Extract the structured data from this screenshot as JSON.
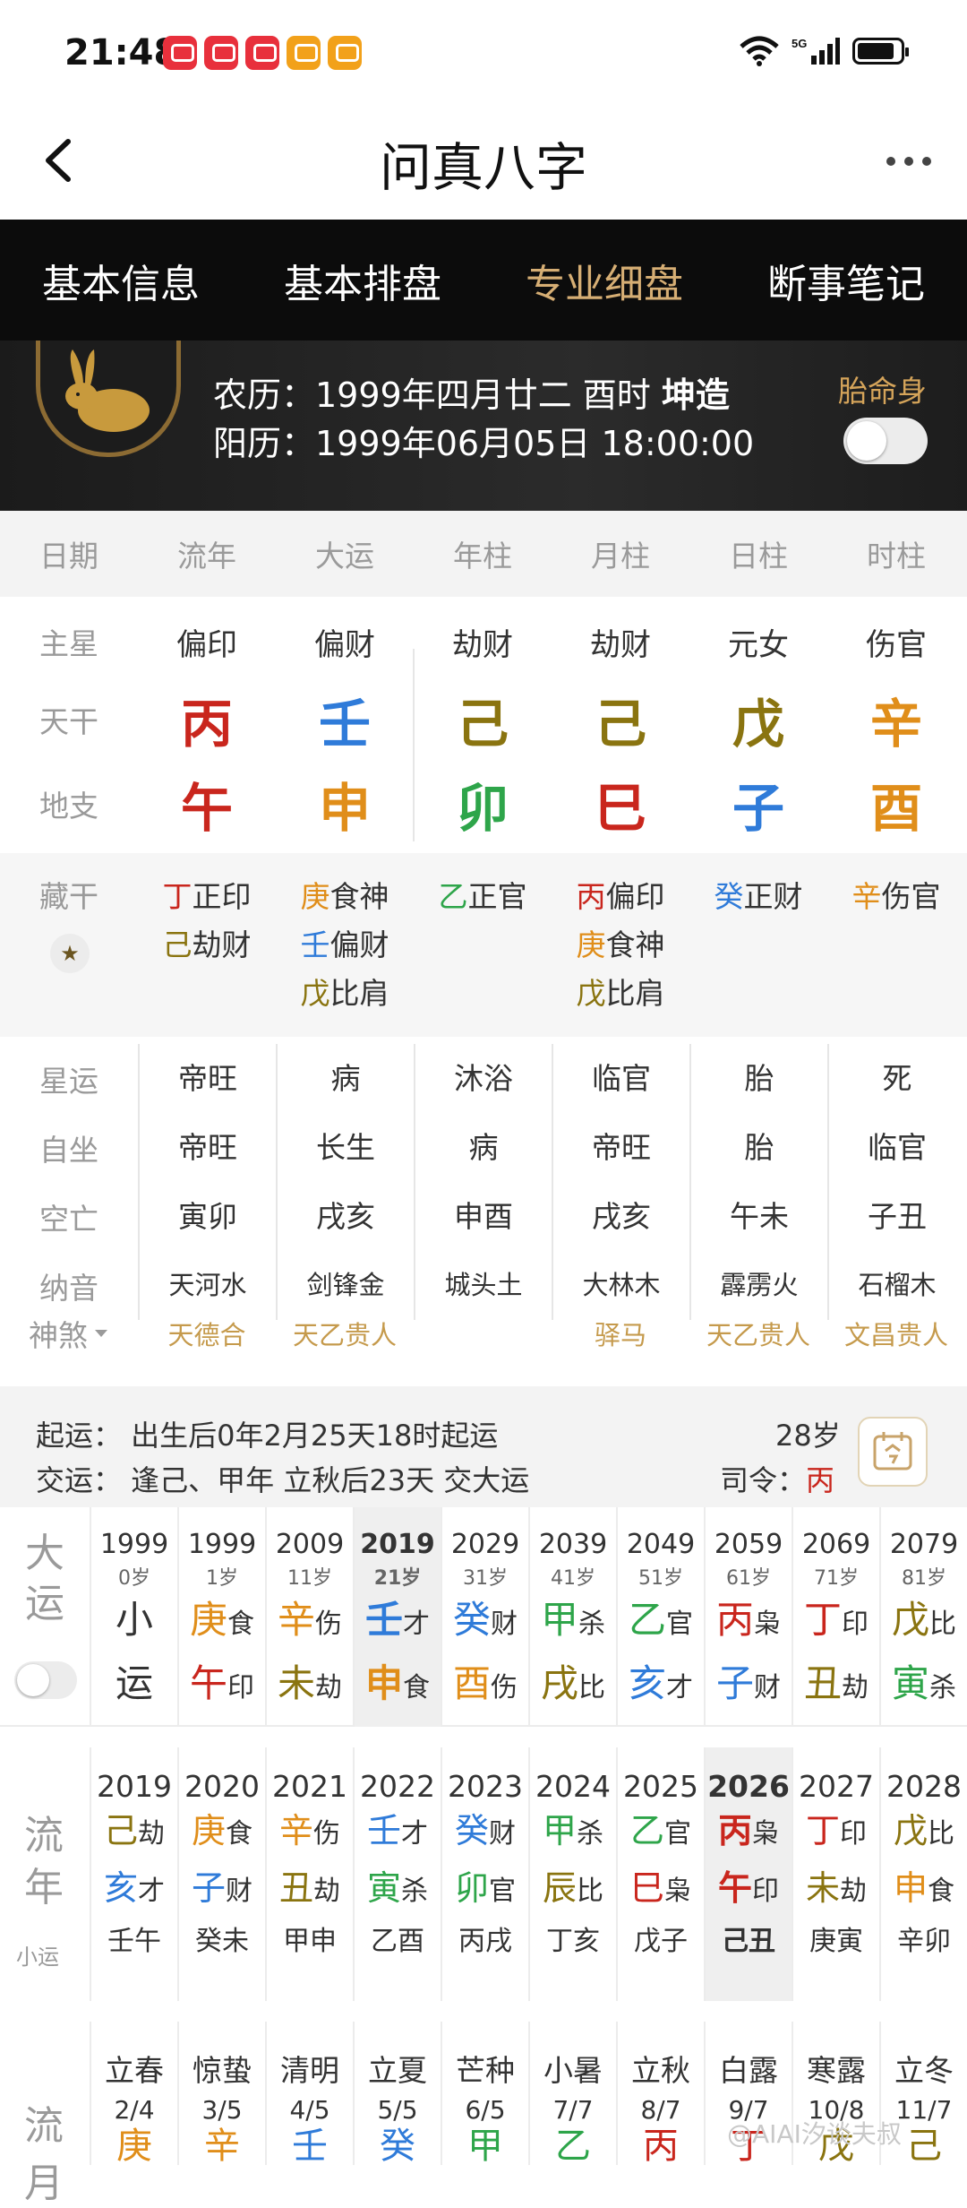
{
  "status": {
    "time": "21:48"
  },
  "appbar": {
    "title": "问真八字"
  },
  "tabs": [
    "基本信息",
    "基本排盘",
    "专业细盘",
    "断事笔记"
  ],
  "profile": {
    "lunar_prefix": "农历：1999年四月廿二 酉时",
    "lunar_bold": "坤造",
    "solar": "阳历：1999年06月05日 18:00:00",
    "taiming": "胎命身"
  },
  "header": [
    "日期",
    "流年",
    "大运",
    "年柱",
    "月柱",
    "日柱",
    "时柱"
  ],
  "labels": {
    "zhuxing": "主星",
    "tiangan": "天干",
    "dizhi": "地支",
    "canggan": "藏干"
  },
  "zhuxing": [
    "偏印",
    "偏财",
    "劫财",
    "劫财",
    "元女",
    "伤官"
  ],
  "tiangan": [
    {
      "char": "丙",
      "color": "#c9261d"
    },
    {
      "char": "壬",
      "color": "#2f7bd9"
    },
    {
      "char": "己",
      "color": "#8a7410"
    },
    {
      "char": "己",
      "color": "#8a7410"
    },
    {
      "char": "戊",
      "color": "#8a7410"
    },
    {
      "char": "辛",
      "color": "#e08e1a"
    }
  ],
  "dizhi": [
    {
      "char": "午",
      "color": "#c9261d"
    },
    {
      "char": "申",
      "color": "#e08e1a"
    },
    {
      "char": "卯",
      "color": "#2ea54a"
    },
    {
      "char": "巳",
      "color": "#c9261d"
    },
    {
      "char": "子",
      "color": "#2f7bd9"
    },
    {
      "char": "酉",
      "color": "#e08e1a"
    }
  ],
  "canggan": [
    [
      {
        "g": "丁",
        "c": "#c9261d",
        "t": "正印"
      },
      {
        "g": "己",
        "c": "#8a7410",
        "t": "劫财"
      }
    ],
    [
      {
        "g": "庚",
        "c": "#e08e1a",
        "t": "食神"
      },
      {
        "g": "壬",
        "c": "#2f7bd9",
        "t": "偏财"
      },
      {
        "g": "戊",
        "c": "#8a7410",
        "t": "比肩"
      }
    ],
    [
      {
        "g": "乙",
        "c": "#2ea54a",
        "t": "正官"
      }
    ],
    [
      {
        "g": "丙",
        "c": "#c9261d",
        "t": "偏印"
      },
      {
        "g": "庚",
        "c": "#e08e1a",
        "t": "食神"
      },
      {
        "g": "戊",
        "c": "#8a7410",
        "t": "比肩"
      }
    ],
    [
      {
        "g": "癸",
        "c": "#2f7bd9",
        "t": "正财"
      }
    ],
    [
      {
        "g": "辛",
        "c": "#e08e1a",
        "t": "伤官"
      }
    ]
  ],
  "section": {
    "rows": [
      {
        "label": "星运",
        "cells": [
          "帝旺",
          "病",
          "沐浴",
          "临官",
          "胎",
          "死"
        ]
      },
      {
        "label": "自坐",
        "cells": [
          "帝旺",
          "长生",
          "病",
          "帝旺",
          "胎",
          "临官"
        ]
      },
      {
        "label": "空亡",
        "cells": [
          "寅卯",
          "戌亥",
          "申酉",
          "戌亥",
          "午未",
          "子丑"
        ]
      },
      {
        "label": "纳音",
        "cells": [
          "天河水",
          "剑锋金",
          "城头土",
          "大林木",
          "霹雳火",
          "石榴木"
        ]
      }
    ],
    "shensha_label": "神煞",
    "shensha": [
      "天德合",
      "天乙贵人",
      "",
      "驿马",
      "天乙贵人",
      "文昌贵人"
    ]
  },
  "qiyun": {
    "line1": "起运：  出生后0年2月25天18时起运",
    "line2": "交运：  逢己、甲年 立秋后23天 交大运",
    "age": "28岁",
    "siling_label": "司令：",
    "siling_value": "丙"
  },
  "dayun": {
    "label": "大运",
    "items": [
      {
        "year": "1999",
        "age": "0岁",
        "top": "小",
        "topc": "#333333",
        "tops": "",
        "bot": "运",
        "botc": "#333333",
        "bots": "",
        "sel": false
      },
      {
        "year": "1999",
        "age": "1岁",
        "top": "庚",
        "topc": "#e08e1a",
        "tops": "食",
        "bot": "午",
        "botc": "#c9261d",
        "bots": "印",
        "sel": false
      },
      {
        "year": "2009",
        "age": "11岁",
        "top": "辛",
        "topc": "#e08e1a",
        "tops": "伤",
        "bot": "未",
        "botc": "#8a7410",
        "bots": "劫",
        "sel": false
      },
      {
        "year": "2019",
        "age": "21岁",
        "top": "壬",
        "topc": "#2f7bd9",
        "tops": "才",
        "bot": "申",
        "botc": "#e08e1a",
        "bots": "食",
        "sel": true
      },
      {
        "year": "2029",
        "age": "31岁",
        "top": "癸",
        "topc": "#2f7bd9",
        "tops": "财",
        "bot": "酉",
        "botc": "#e08e1a",
        "bots": "伤",
        "sel": false
      },
      {
        "year": "2039",
        "age": "41岁",
        "top": "甲",
        "topc": "#2ea54a",
        "tops": "杀",
        "bot": "戌",
        "botc": "#8a7410",
        "bots": "比",
        "sel": false
      },
      {
        "year": "2049",
        "age": "51岁",
        "top": "乙",
        "topc": "#2ea54a",
        "tops": "官",
        "bot": "亥",
        "botc": "#2f7bd9",
        "bots": "才",
        "sel": false
      },
      {
        "year": "2059",
        "age": "61岁",
        "top": "丙",
        "topc": "#c9261d",
        "tops": "枭",
        "bot": "子",
        "botc": "#2f7bd9",
        "bots": "财",
        "sel": false
      },
      {
        "year": "2069",
        "age": "71岁",
        "top": "丁",
        "topc": "#c9261d",
        "tops": "印",
        "bot": "丑",
        "botc": "#8a7410",
        "bots": "劫",
        "sel": false
      },
      {
        "year": "2079",
        "age": "81岁",
        "top": "戊",
        "topc": "#8a7410",
        "tops": "比",
        "bot": "寅",
        "botc": "#2ea54a",
        "bots": "杀",
        "sel": false
      }
    ]
  },
  "liunian": {
    "label": "流年",
    "sub": "小运",
    "items": [
      {
        "year": "2019",
        "top": "己",
        "topc": "#8a7410",
        "tops": "劫",
        "bot": "亥",
        "botc": "#2f7bd9",
        "bots": "才",
        "extra": "壬午",
        "sel": false
      },
      {
        "year": "2020",
        "top": "庚",
        "topc": "#e08e1a",
        "tops": "食",
        "bot": "子",
        "botc": "#2f7bd9",
        "bots": "财",
        "extra": "癸未",
        "sel": false
      },
      {
        "year": "2021",
        "top": "辛",
        "topc": "#e08e1a",
        "tops": "伤",
        "bot": "丑",
        "botc": "#8a7410",
        "bots": "劫",
        "extra": "甲申",
        "sel": false
      },
      {
        "year": "2022",
        "top": "壬",
        "topc": "#2f7bd9",
        "tops": "才",
        "bot": "寅",
        "botc": "#2ea54a",
        "bots": "杀",
        "extra": "乙酉",
        "sel": false
      },
      {
        "year": "2023",
        "top": "癸",
        "topc": "#2f7bd9",
        "tops": "财",
        "bot": "卯",
        "botc": "#2ea54a",
        "bots": "官",
        "extra": "丙戌",
        "sel": false
      },
      {
        "year": "2024",
        "top": "甲",
        "topc": "#2ea54a",
        "tops": "杀",
        "bot": "辰",
        "botc": "#8a7410",
        "bots": "比",
        "extra": "丁亥",
        "sel": false
      },
      {
        "year": "2025",
        "top": "乙",
        "topc": "#2ea54a",
        "tops": "官",
        "bot": "巳",
        "botc": "#c9261d",
        "bots": "枭",
        "extra": "戊子",
        "sel": false
      },
      {
        "year": "2026",
        "top": "丙",
        "topc": "#c9261d",
        "tops": "枭",
        "bot": "午",
        "botc": "#c9261d",
        "bots": "印",
        "extra": "己丑",
        "sel": true
      },
      {
        "year": "2027",
        "top": "丁",
        "topc": "#c9261d",
        "tops": "印",
        "bot": "未",
        "botc": "#8a7410",
        "bots": "劫",
        "extra": "庚寅",
        "sel": false
      },
      {
        "year": "2028",
        "top": "戊",
        "topc": "#8a7410",
        "tops": "比",
        "bot": "申",
        "botc": "#e08e1a",
        "bots": "食",
        "extra": "辛卯",
        "sel": false
      }
    ]
  },
  "liuyue": {
    "label": "流月",
    "items": [
      {
        "term": "立春",
        "date": "2/4",
        "g": "庚",
        "gc": "#e08e1a"
      },
      {
        "term": "惊蛰",
        "date": "3/5",
        "g": "辛",
        "gc": "#e08e1a"
      },
      {
        "term": "清明",
        "date": "4/5",
        "g": "壬",
        "gc": "#2f7bd9"
      },
      {
        "term": "立夏",
        "date": "5/5",
        "g": "癸",
        "gc": "#2f7bd9"
      },
      {
        "term": "芒种",
        "date": "6/5",
        "g": "甲",
        "gc": "#2ea54a"
      },
      {
        "term": "小暑",
        "date": "7/7",
        "g": "乙",
        "gc": "#2ea54a"
      },
      {
        "term": "立秋",
        "date": "8/7",
        "g": "丙",
        "gc": "#c9261d"
      },
      {
        "term": "白露",
        "date": "9/7",
        "g": "丁",
        "gc": "#c9261d"
      },
      {
        "term": "寒露",
        "date": "10/8",
        "g": "戊",
        "gc": "#8a7410"
      },
      {
        "term": "立冬",
        "date": "11/7",
        "g": "己",
        "gc": "#8a7410"
      }
    ]
  },
  "watermark": "@AIAI汐谈夫叔"
}
